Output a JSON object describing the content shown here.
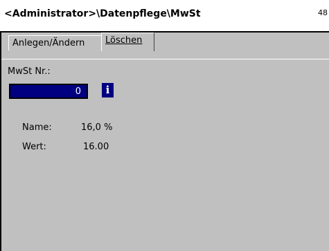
{
  "header": {
    "title": "<Administrator>\\Datenpflege\\MwSt",
    "right_text": "48"
  },
  "tabs": [
    {
      "label": "Anlegen/Ändern",
      "active": false
    },
    {
      "label": "Löschen",
      "active": true
    }
  ],
  "form": {
    "mwst_label": "MwSt Nr.:",
    "mwst_value": "0",
    "info_icon": "info-icon",
    "name_label": "Name:",
    "name_value": "16,0 %",
    "wert_label": "Wert:",
    "wert_value": "16.00"
  },
  "colors": {
    "panel_bg": "#c0c0c0",
    "field_bg": "#000080",
    "field_text": "#ffffff"
  }
}
